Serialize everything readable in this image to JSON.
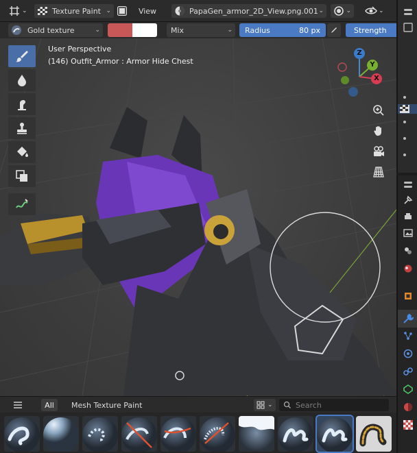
{
  "header": {
    "mode_label": "Texture Paint",
    "view_label": "View",
    "image_name": "PapaGen_armor_2D_View.png.001"
  },
  "tool_settings": {
    "brush_name": "Gold texture",
    "blend_mode": "Mix",
    "radius_label": "Radius",
    "radius_value": "80 px",
    "strength_label": "Strength",
    "colors": {
      "primary": "#c85858",
      "secondary": "#ffffff"
    }
  },
  "viewport": {
    "perspective_label": "User Perspective",
    "object_label": "(146) Outfit_Armor : Armor Hide Chest",
    "gizmo": {
      "x": "X",
      "y": "Y",
      "z": "Z"
    }
  },
  "left_tools": [
    {
      "icon": "paint-brush-icon",
      "active": true
    },
    {
      "icon": "soften-icon",
      "active": false
    },
    {
      "icon": "smear-icon",
      "active": false
    },
    {
      "icon": "clone-stamp-icon",
      "active": false
    },
    {
      "icon": "fill-bucket-icon",
      "active": false
    },
    {
      "icon": "mask-icon",
      "active": false
    },
    {
      "icon": "annotate-icon",
      "active": false
    }
  ],
  "asset_shelf": {
    "tab_all": "All",
    "tab_catalog": "Mesh Texture Paint",
    "search_placeholder": "Search",
    "brushes": [
      {
        "icon": "brush-preview-1-icon",
        "selected": false
      },
      {
        "icon": "brush-preview-2-icon",
        "selected": false
      },
      {
        "icon": "brush-preview-3-icon",
        "selected": false
      },
      {
        "icon": "brush-preview-4-icon",
        "selected": false
      },
      {
        "icon": "brush-preview-5-icon",
        "selected": false
      },
      {
        "icon": "brush-preview-6-icon",
        "selected": false
      },
      {
        "icon": "brush-preview-7-icon",
        "selected": false
      },
      {
        "icon": "brush-preview-8-icon",
        "selected": false
      },
      {
        "icon": "brush-preview-9-icon",
        "selected": true
      },
      {
        "icon": "brush-preview-10-icon",
        "selected": false
      }
    ]
  },
  "theme": {
    "accent": "#4a7ac4",
    "active_tool": "#4a6fa8"
  }
}
